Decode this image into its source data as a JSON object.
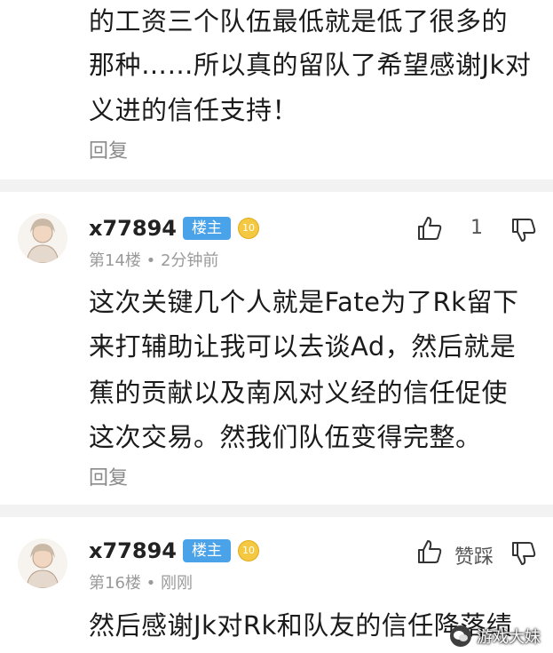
{
  "comment_top": {
    "lines": [
      "的工资三个队伍最低就是低了很多的",
      "那种……所以真的留队了希望感谢Jk对",
      "义进的信任支持！"
    ],
    "reply_label": "回复"
  },
  "comment_1": {
    "username": "x77894",
    "host_badge": "楼主",
    "level_badge": "10",
    "meta": "第14楼 • 2分钟前",
    "vote_count": "1",
    "lines": [
      "这次关键几个人就是Fate为了Rk留下",
      "来打辅助让我可以去谈Ad，然后就是",
      "蕉的贡献以及南风对义经的信任促使",
      "这次交易。然我们队伍变得完整。"
    ],
    "reply_label": "回复"
  },
  "comment_2": {
    "username": "x77894",
    "host_badge": "楼主",
    "level_badge": "10",
    "meta": "第16楼 • 刚刚",
    "vote_label": "赞踩",
    "lines": [
      "然后感谢Jk对Rk和队友的信任降落绩"
    ]
  },
  "watermark": {
    "text": "游戏大妹"
  }
}
